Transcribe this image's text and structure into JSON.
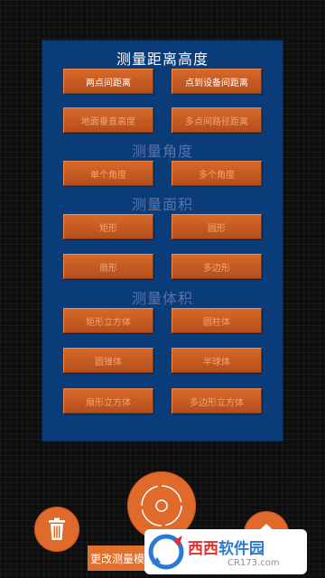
{
  "panel": {
    "height_section": {
      "title": "测量距离高度",
      "buttons": [
        "两点间距离",
        "点到设备间距离",
        "地面垂直高度",
        "多点间路径距离"
      ]
    },
    "angle_section": {
      "title": "测量角度",
      "buttons": [
        "单个角度",
        "多个角度"
      ]
    },
    "area_section": {
      "title": "测量面积",
      "buttons": [
        "矩形",
        "圆形",
        "扇形",
        "多边形"
      ]
    },
    "volume_section": {
      "title": "测量体积",
      "buttons": [
        "矩形立方体",
        "圆柱体",
        "圆锥体",
        "半球体",
        "扇形立方体",
        "多边形立方体"
      ]
    }
  },
  "bottom_bar": {
    "mode_label": "更改测量模"
  },
  "watermark": {
    "brand_red": "西西",
    "brand_blue": "软件园",
    "domain": "CR173.com"
  },
  "icons": {
    "delete": "trash-icon",
    "capture": "crosshair-icon",
    "home": "home-icon"
  },
  "colors": {
    "panel": "#0b3c7a",
    "button": "#d8692a",
    "accent": "#e06a2c"
  }
}
